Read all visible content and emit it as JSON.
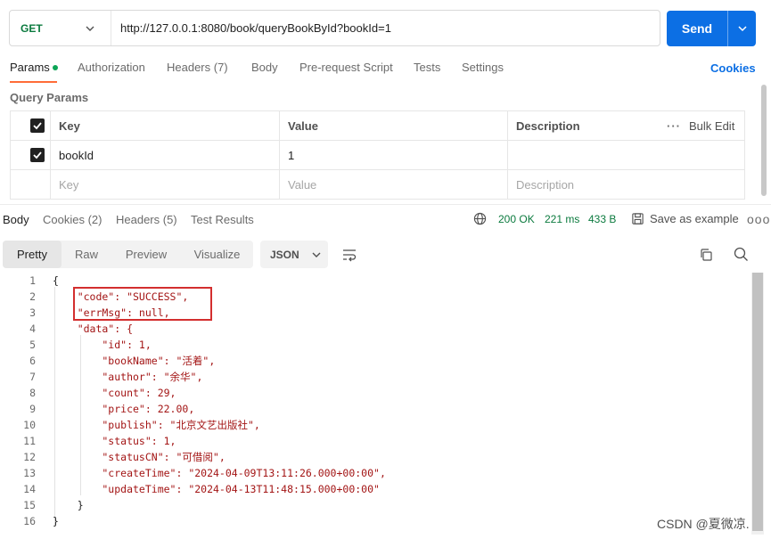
{
  "request": {
    "method": "GET",
    "url": "http://127.0.0.1:8080/book/queryBookById?bookId=1",
    "send_label": "Send"
  },
  "request_tabs": [
    {
      "label": "Params",
      "active": true,
      "has_dot": true
    },
    {
      "label": "Authorization"
    },
    {
      "label": "Headers (7)"
    },
    {
      "label": "Body"
    },
    {
      "label": "Pre-request Script"
    },
    {
      "label": "Tests"
    },
    {
      "label": "Settings"
    }
  ],
  "cookies_link": "Cookies",
  "query_params": {
    "title": "Query Params",
    "headers": {
      "key": "Key",
      "value": "Value",
      "description": "Description",
      "bulk_edit": "Bulk Edit"
    },
    "rows": [
      {
        "key": "bookId",
        "value": "1",
        "checked": true
      }
    ],
    "placeholder": {
      "key": "Key",
      "value": "Value",
      "description": "Description"
    }
  },
  "response_tabs": [
    {
      "label": "Body",
      "active": true
    },
    {
      "label": "Cookies (2)"
    },
    {
      "label": "Headers (5)"
    },
    {
      "label": "Test Results"
    }
  ],
  "response_status": {
    "status": "200 OK",
    "time": "221 ms",
    "size": "433 B"
  },
  "save_example": "Save as example",
  "view_modes": [
    "Pretty",
    "Raw",
    "Preview",
    "Visualize"
  ],
  "active_view": "Pretty",
  "format": "JSON",
  "code_lines": [
    "{",
    "    \"code\": \"SUCCESS\",",
    "    \"errMsg\": null,",
    "    \"data\": {",
    "        \"id\": 1,",
    "        \"bookName\": \"活着\",",
    "        \"author\": \"余华\",",
    "        \"count\": 29,",
    "        \"price\": 22.00,",
    "        \"publish\": \"北京文艺出版社\",",
    "        \"status\": 1,",
    "        \"statusCN\": \"可借阅\",",
    "        \"createTime\": \"2024-04-09T13:11:26.000+00:00\",",
    "        \"updateTime\": \"2024-04-13T11:48:15.000+00:00\"",
    "    }",
    "}"
  ],
  "watermark": "CSDN @夏微凉.",
  "colors": {
    "accent": "#0c6fe4",
    "tab_underline": "#ff6c37",
    "status_ok": "#0b7a3e",
    "highlight_box": "#d32f2f"
  }
}
